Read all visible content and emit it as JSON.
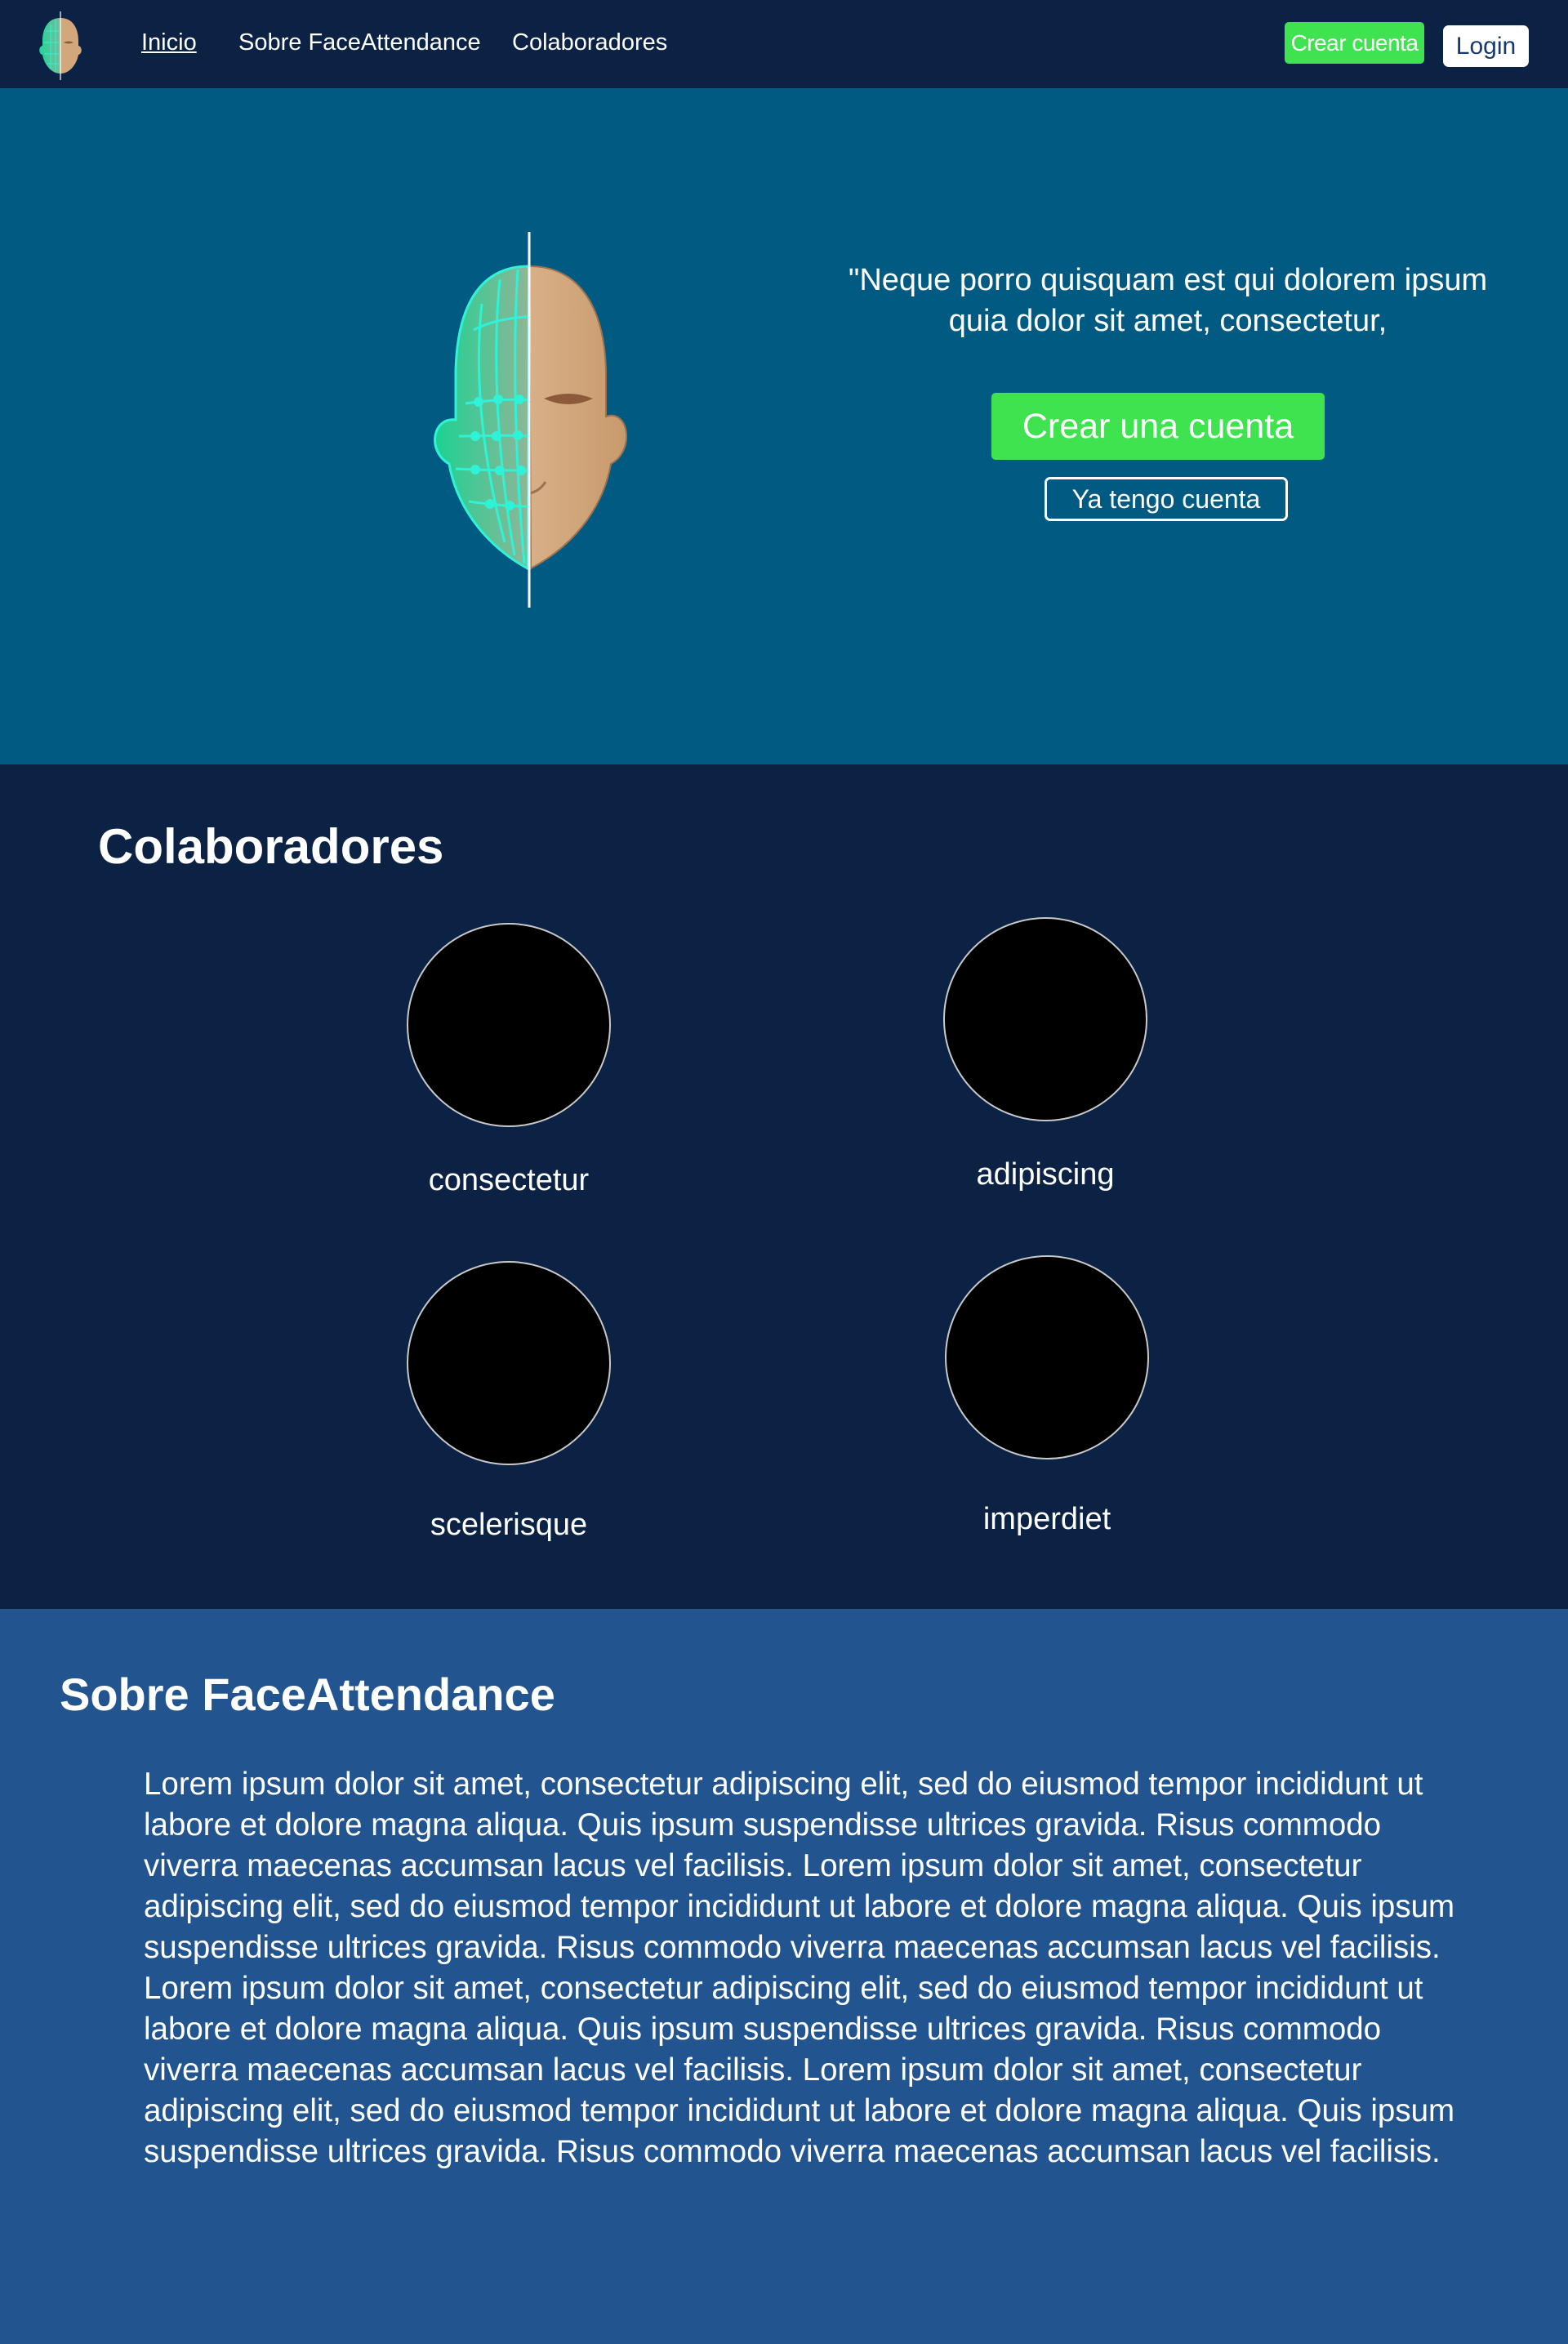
{
  "nav": {
    "links": [
      {
        "label": "Inicio",
        "active": true
      },
      {
        "label": "Sobre FaceAttendance",
        "active": false
      },
      {
        "label": "Colaboradores",
        "active": false
      }
    ],
    "create_account_label": "Crear cuenta",
    "login_label": "Login"
  },
  "hero": {
    "quote": "\"Neque porro quisquam est qui dolorem ipsum quia dolor sit amet, consectetur,",
    "primary_button": "Crear una cuenta",
    "secondary_button": "Ya tengo cuenta"
  },
  "collaborators": {
    "title": "Colaboradores",
    "members": [
      {
        "name": "consectetur"
      },
      {
        "name": "adipiscing"
      },
      {
        "name": "scelerisque"
      },
      {
        "name": "imperdiet"
      }
    ]
  },
  "about": {
    "title": "Sobre FaceAttendance",
    "body": "Lorem ipsum dolor sit amet, consectetur adipiscing elit, sed do eiusmod tempor incididunt ut labore et dolore magna aliqua. Quis ipsum suspendisse ultrices gravida. Risus commodo viverra maecenas accumsan lacus vel facilisis. Lorem ipsum dolor sit amet, consectetur adipiscing elit, sed do eiusmod tempor incididunt ut labore et dolore magna aliqua. Quis ipsum suspendisse ultrices gravida. Risus commodo viverra maecenas accumsan lacus vel facilisis. Lorem ipsum dolor sit amet, consectetur adipiscing elit, sed do eiusmod tempor incididunt ut labore et dolore magna aliqua. Quis ipsum suspendisse ultrices gravida. Risus commodo viverra maecenas accumsan lacus vel facilisis. Lorem ipsum dolor sit amet, consectetur adipiscing elit, sed do eiusmod tempor incididunt ut labore et dolore magna aliqua. Quis ipsum suspendisse ultrices gravida. Risus commodo viverra maecenas accumsan lacus vel facilisis."
  },
  "colors": {
    "navbar_bg": "#0b2245",
    "hero_bg": "#005a82",
    "accent_green": "#3fe24f",
    "collab_bg": "#0b2245",
    "about_bg": "#22548f"
  },
  "icons": {
    "logo": "face-scan-logo-icon",
    "hero_illustration": "face-scan-illustration-icon",
    "avatar": "avatar-placeholder-icon"
  }
}
